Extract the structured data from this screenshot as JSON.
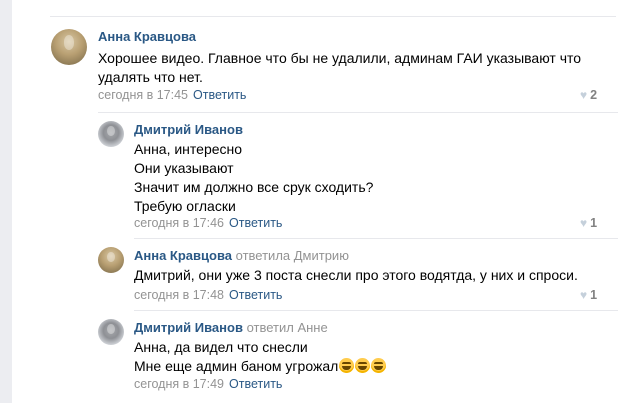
{
  "comments": [
    {
      "author": "Анна Кравцова",
      "reply_to": "",
      "text": "Хорошее видео. Главное что бы не удалили, админам ГАИ указывают что\nудалять что нет.",
      "time": "сегодня в 17:45",
      "reply_label": "Ответить",
      "likes": "2"
    },
    {
      "author": "Дмитрий Иванов",
      "reply_to": "",
      "text": "Анна, интересно\nОни указывают\nЗначит им должно все срук сходить?\nТребую огласки",
      "time": "сегодня в 17:46",
      "reply_label": "Ответить",
      "likes": "1"
    },
    {
      "author": "Анна Кравцова",
      "reply_to": "ответила Дмитрию",
      "text": "Дмитрий, они уже 3 поста снесли про этого водятда, у них и спроси.",
      "time": "сегодня в 17:48",
      "reply_label": "Ответить",
      "likes": "1"
    },
    {
      "author": "Дмитрий Иванов",
      "reply_to": "ответил Анне",
      "text_line1": "Анна, да видел что снесли",
      "text_line2": "Мне еще админ баном угрожал",
      "time": "сегодня в 17:49",
      "reply_label": "Ответить",
      "emoji_icon": "rolling-on-floor-laughing-icon"
    }
  ],
  "colors": {
    "author": "#2a5885",
    "meta": "#939393",
    "heart": "#c5d0db",
    "separator": "#e7e8ec"
  }
}
